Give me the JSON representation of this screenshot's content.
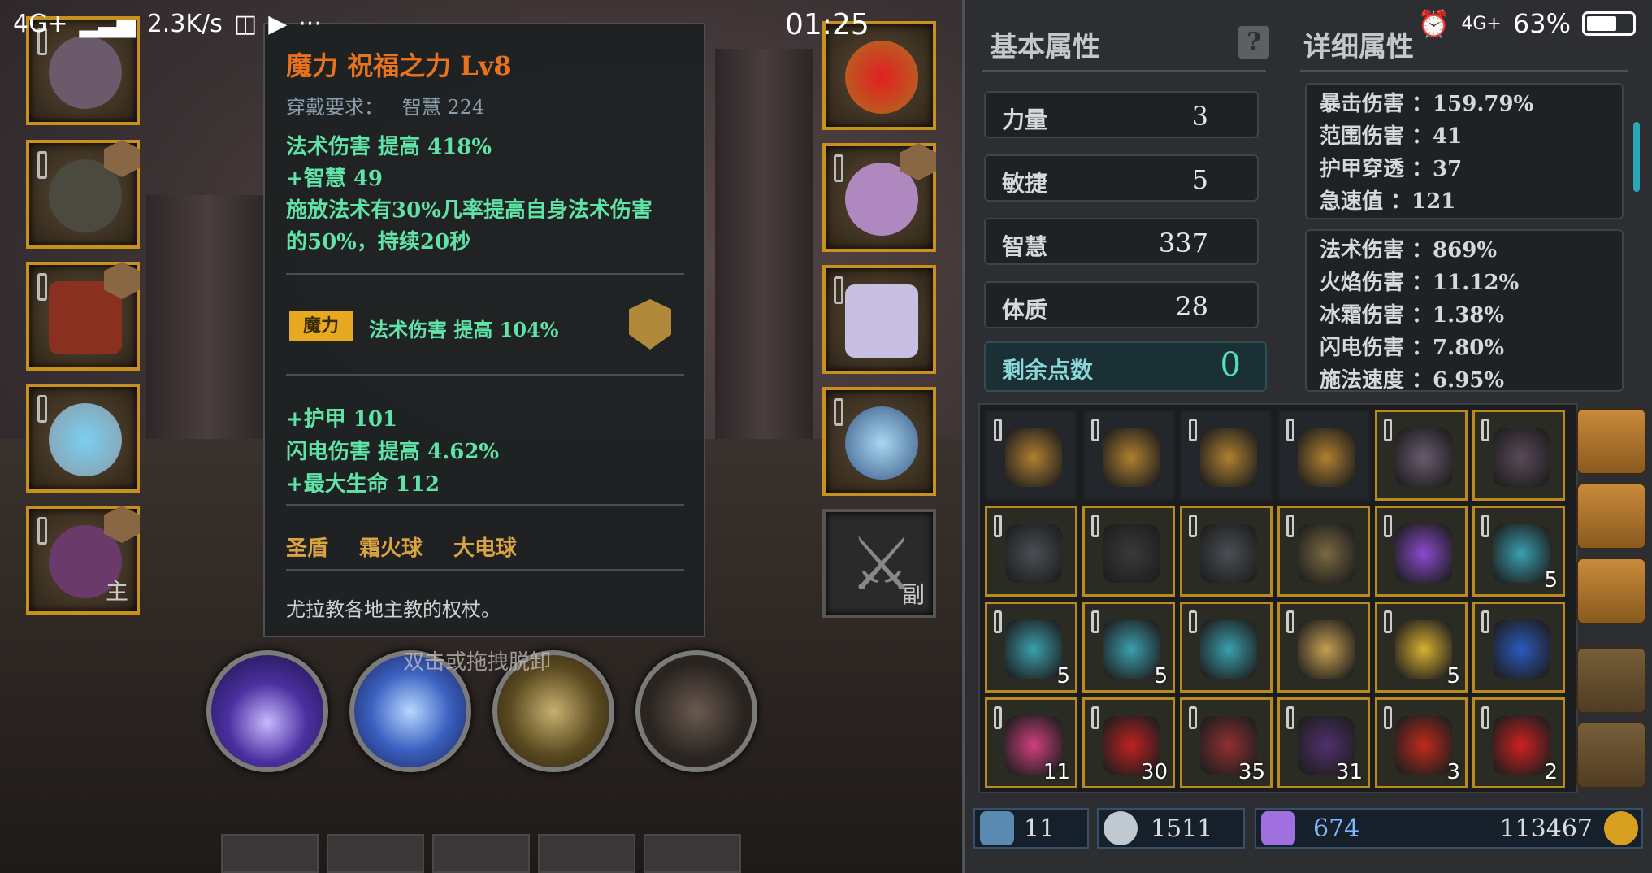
{
  "status_bar": {
    "network": "4G+",
    "speed": "2.3K/s",
    "time": "01:25",
    "network_right": "4G+",
    "battery": "63%"
  },
  "tooltip": {
    "title": "魔力 祝福之力 Lv8",
    "requirement_label": "穿戴要求：",
    "requirement_value": "智慧 224",
    "lines1": [
      "法术伤害 提高 418%",
      "+智慧 49",
      "施放法术有30%几率提高自身法术伤害",
      "的50%，持续20秒"
    ],
    "gem_tag": "魔力",
    "gem_text": "法术伤害 提高 104%",
    "lines2": [
      "+护甲 101",
      "闪电伤害 提高 4.62%",
      "+最大生命 112"
    ],
    "skills": [
      "圣盾",
      "霜火球",
      "大电球"
    ],
    "flavor": "尤拉教各地主教的权杖。"
  },
  "hint": "双击或拖拽脱卸",
  "left_slots": [
    {
      "tag": ""
    },
    {
      "tag": ""
    },
    {
      "tag": ""
    },
    {
      "tag": ""
    },
    {
      "tag": "主"
    }
  ],
  "right_slots": [
    {
      "tag": ""
    },
    {
      "tag": ""
    },
    {
      "tag": ""
    },
    {
      "tag": ""
    },
    {
      "tag": "副"
    }
  ],
  "panel": {
    "basic_title": "基本属性",
    "detail_title": "详细属性",
    "help": "?",
    "stats": [
      {
        "label": "力量",
        "value": "3"
      },
      {
        "label": "敏捷",
        "value": "5"
      },
      {
        "label": "智慧",
        "value": "337"
      },
      {
        "label": "体质",
        "value": "28"
      }
    ],
    "points": {
      "label": "剩余点数",
      "value": "0"
    },
    "detail1": [
      "暴击伤害 ：159.79%",
      "范围伤害 ：41",
      "护甲穿透 ：37",
      "急速值 ：121"
    ],
    "detail2": [
      "法术伤害 ：869%",
      "火焰伤害 ：11.12%",
      "冰霜伤害 ：1.38%",
      "闪电伤害 ：7.80%",
      "施法速度 ：6.95%"
    ]
  },
  "inventory": {
    "rows": [
      [
        {
          "icon": "backpack-icon",
          "count": "",
          "color": "#b08030",
          "plain": true
        },
        {
          "icon": "backpack-icon",
          "count": "",
          "color": "#b08030",
          "plain": true
        },
        {
          "icon": "backpack-icon",
          "count": "",
          "color": "#b08030",
          "plain": true
        },
        {
          "icon": "backpack-icon",
          "count": "",
          "color": "#b08030",
          "plain": true
        },
        {
          "icon": "helmet-icon",
          "count": "",
          "color": "#6a5a70",
          "plain": false
        },
        {
          "icon": "boots-icon",
          "count": "",
          "color": "#5a4a5a",
          "plain": false
        }
      ],
      [
        {
          "icon": "armor-icon",
          "count": "",
          "color": "#4a4f55",
          "plain": false
        },
        {
          "icon": "hood-icon",
          "count": "",
          "color": "#3a3a3a",
          "plain": false
        },
        {
          "icon": "gauntlet-icon",
          "count": "",
          "color": "#4a4f55",
          "plain": false
        },
        {
          "icon": "amulet-icon",
          "count": "",
          "color": "#7a6a40",
          "plain": false
        },
        {
          "icon": "gem-icon",
          "count": "",
          "color": "#8a4ad0",
          "plain": false
        },
        {
          "icon": "scroll-icon",
          "count": "5",
          "color": "#3aa0b0",
          "plain": false
        }
      ],
      [
        {
          "icon": "scroll-icon",
          "count": "5",
          "color": "#3aa0b0",
          "plain": false
        },
        {
          "icon": "scroll-icon",
          "count": "5",
          "color": "#3aa0b0",
          "plain": false
        },
        {
          "icon": "scroll-icon",
          "count": "",
          "color": "#3aa0b0",
          "plain": false
        },
        {
          "icon": "map-scroll-icon",
          "count": "",
          "color": "#c8a050",
          "plain": false
        },
        {
          "icon": "map-scroll-icon",
          "count": "5",
          "color": "#d8b030",
          "plain": false
        },
        {
          "icon": "orb-icon",
          "count": "",
          "color": "#2a5ac0",
          "plain": false
        }
      ],
      [
        {
          "icon": "ruby-icon",
          "count": "11",
          "color": "#d04080",
          "plain": false
        },
        {
          "icon": "crystal-icon",
          "count": "30",
          "color": "#c02020",
          "plain": false
        },
        {
          "icon": "ore-icon",
          "count": "35",
          "color": "#903030",
          "plain": false
        },
        {
          "icon": "dark-crystal-icon",
          "count": "31",
          "color": "#503070",
          "plain": false
        },
        {
          "icon": "red-orb-icon",
          "count": "3",
          "color": "#c02a1a",
          "plain": false
        },
        {
          "icon": "red-gem-icon",
          "count": "2",
          "color": "#d02020",
          "plain": false
        }
      ]
    ]
  },
  "currency": {
    "wand": "11",
    "potion": "1511",
    "crystal": "674",
    "gold": "113467"
  }
}
